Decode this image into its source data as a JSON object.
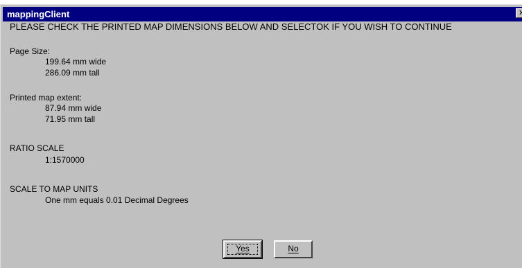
{
  "window": {
    "title": "mappingClient",
    "close_glyph": "✕"
  },
  "message": {
    "heading": "PLEASE CHECK THE PRINTED MAP DIMENSIONS BELOW AND SELECTOK IF YOU WISH TO CONTINUE",
    "page_size": {
      "label": "Page Size:",
      "width": "199.64 mm wide",
      "height": "286.09 mm tall"
    },
    "printed_extent": {
      "label": "Printed map extent:",
      "width": "87.94 mm wide",
      "height": "71.95 mm tall"
    },
    "ratio_scale": {
      "label": "RATIO SCALE",
      "value": "1:1570000"
    },
    "scale_units": {
      "label": "SCALE TO MAP UNITS",
      "value": "One mm equals 0.01 Decimal Degrees"
    }
  },
  "buttons": {
    "yes_label": "Yes",
    "no_label": "No"
  },
  "icons": {
    "close": "close-icon"
  }
}
